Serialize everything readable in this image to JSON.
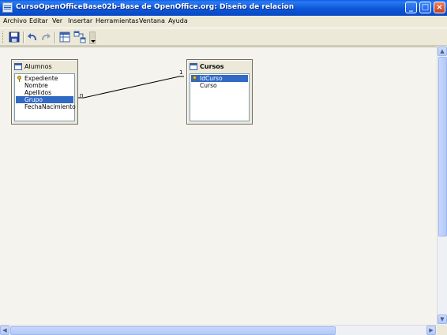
{
  "window": {
    "title": "CursoOpenOfficeBase02b-Base de OpenOffice.org: Diseño de relacion",
    "minimize": "_",
    "maximize": "□",
    "close": "×"
  },
  "menu": {
    "items": [
      "Archivo",
      "Editar",
      "Ver",
      "Insertar",
      "Herramientas",
      "Ventana",
      "Ayuda"
    ]
  },
  "toolbar": {
    "buttons": [
      "save-icon",
      "undo-icon",
      "redo-icon",
      "add-table-icon",
      "new-relation-icon"
    ]
  },
  "tables": {
    "alumnos": {
      "title": "Alumnos",
      "fields": [
        "Expediente",
        "Nombre",
        "Apellidos",
        "Grupo",
        "FechaNacimiento"
      ],
      "key_field": "Expediente",
      "selected_field": "Grupo"
    },
    "cursos": {
      "title": "Cursos",
      "fields": [
        "IdCurso",
        "Curso"
      ],
      "key_field": "IdCurso",
      "selected_field": "IdCurso"
    }
  },
  "relation": {
    "from_label": "n",
    "to_label": "1"
  },
  "colors": {
    "titlebar": "#0a5ee6",
    "selection": "#316ac5"
  }
}
